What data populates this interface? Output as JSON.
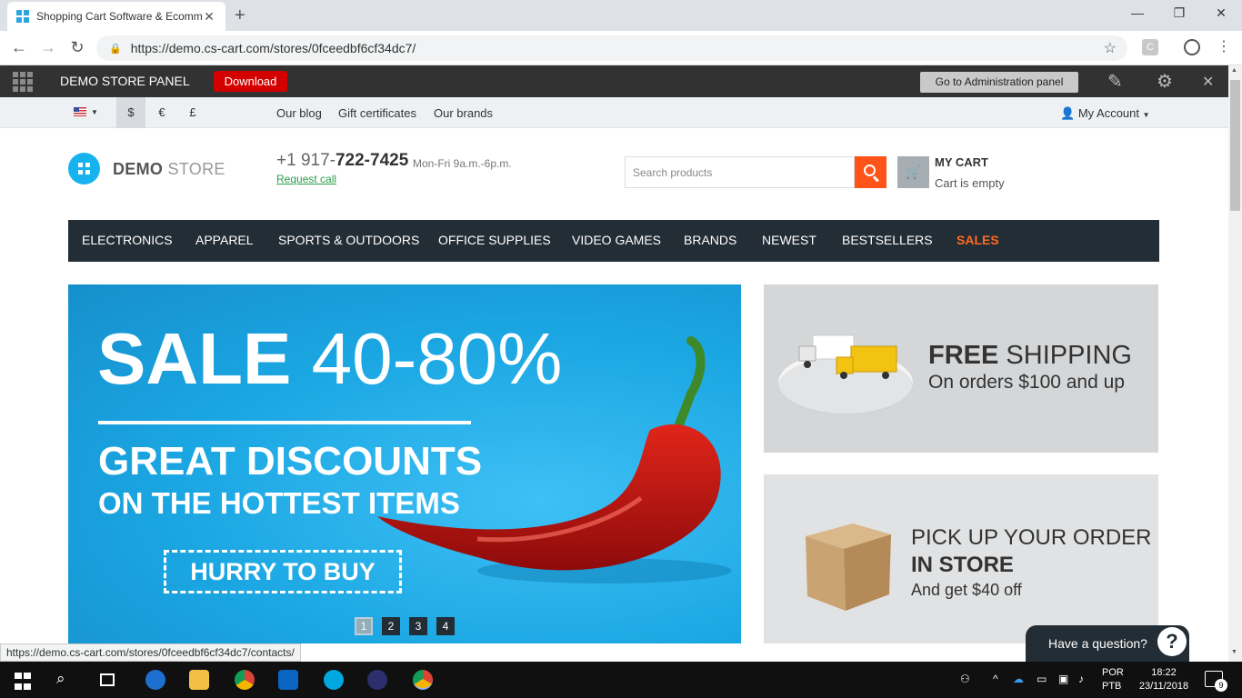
{
  "browser": {
    "tab_title": "Shopping Cart Software & Ecomm",
    "url": "https://demo.cs-cart.com/stores/0fceedbf6cf34dc7/",
    "status_url": "https://demo.cs-cart.com/stores/0fceedbf6cf34dc7/contacts/",
    "ext_label": "C"
  },
  "admin_bar": {
    "title": "DEMO STORE PANEL",
    "download": "Download",
    "admin_panel": "Go to Administration panel"
  },
  "top_bar": {
    "currencies": [
      "$",
      "€",
      "£"
    ],
    "links": [
      "Our blog",
      "Gift certificates",
      "Our brands"
    ],
    "account": "My Account"
  },
  "header": {
    "logo_bold": "DEMO",
    "logo_light": "STORE",
    "phone_prefix": "+1 917-",
    "phone_main": "722-7425",
    "hours": "Mon-Fri 9a.m.-6p.m.",
    "request_call": "Request call",
    "search_placeholder": "Search products",
    "cart_title": "MY CART",
    "cart_status": "Cart is empty"
  },
  "menu": [
    "ELECTRONICS",
    "APPAREL",
    "SPORTS & OUTDOORS",
    "OFFICE SUPPLIES",
    "VIDEO GAMES",
    "BRANDS",
    "NEWEST",
    "BESTSELLERS",
    "SALES"
  ],
  "banner": {
    "sale_word": "SALE",
    "sale_range": "40-80%",
    "discounts": "GREAT DISCOUNTS",
    "hottest": "ON THE HOTTEST ITEMS",
    "cta": "HURRY TO BUY",
    "pages": [
      "1",
      "2",
      "3",
      "4"
    ]
  },
  "side_banners": {
    "shipping_bold": "FREE",
    "shipping_light": "SHIPPING",
    "shipping_sub": "On orders $100 and up",
    "pickup_line1": "PICK UP YOUR ORDER",
    "pickup_line2": "IN STORE",
    "pickup_sub": "And get $40 off"
  },
  "chat": {
    "label": "Have a question?",
    "icon": "?"
  },
  "taskbar": {
    "lang1": "POR",
    "lang2": "PTB",
    "time": "18:22",
    "date": "23/11/2018",
    "notifications": "9"
  },
  "colors": {
    "accent": "#ff5319",
    "menu_bg": "#232d35",
    "sale": "#ff6a22",
    "banner_blue": "#1aa6e2"
  }
}
